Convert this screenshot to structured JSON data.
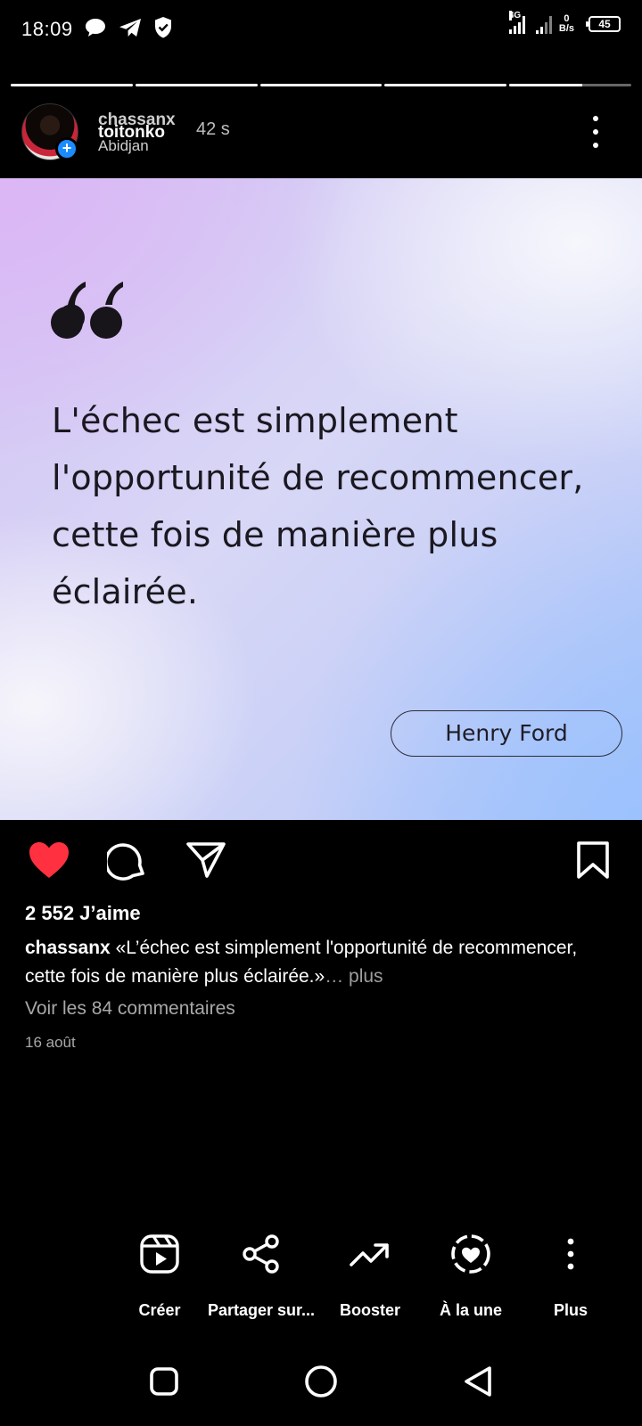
{
  "status_bar": {
    "time": "18:09",
    "network_label": "4G",
    "speed_value": "0",
    "speed_unit": "B/s",
    "battery": "45"
  },
  "story_progress": {
    "segments": 5,
    "active_fraction": 0.6
  },
  "header": {
    "username_top": "chassanx",
    "username_bottom": "toitonko",
    "location": "Abidjan",
    "time_ago": "42 s"
  },
  "post": {
    "quote": "L'échec est simplement l'opportunité de recommencer, cette fois de manière plus éclairée.",
    "author": "Henry Ford",
    "colors": {
      "quote_text": "#1a1820",
      "like_red": "#ff3040"
    }
  },
  "actions": {
    "like_icon": "heart-filled-icon",
    "comment_icon": "comment-icon",
    "share_icon": "send-icon",
    "save_icon": "bookmark-icon"
  },
  "likes": "2 552 J’aime",
  "caption": {
    "user": "chassanx",
    "text": "«L’échec est simplement l'opportunité de recommencer, cette fois de manière plus éclairée.»",
    "more": "… plus"
  },
  "view_comments": "Voir les 84 commentaires",
  "date": "16 août",
  "bottom_actions": [
    {
      "label": "Créer",
      "icon": "reels-create-icon"
    },
    {
      "label": "Partager sur...",
      "icon": "share-icon"
    },
    {
      "label": "Booster",
      "icon": "trending-up-icon"
    },
    {
      "label": "À la une",
      "icon": "highlight-heart-icon"
    },
    {
      "label": "Plus",
      "icon": "more-vertical-icon"
    }
  ],
  "nav": {
    "recent": "square-icon",
    "home": "circle-icon",
    "back": "triangle-back-icon"
  }
}
